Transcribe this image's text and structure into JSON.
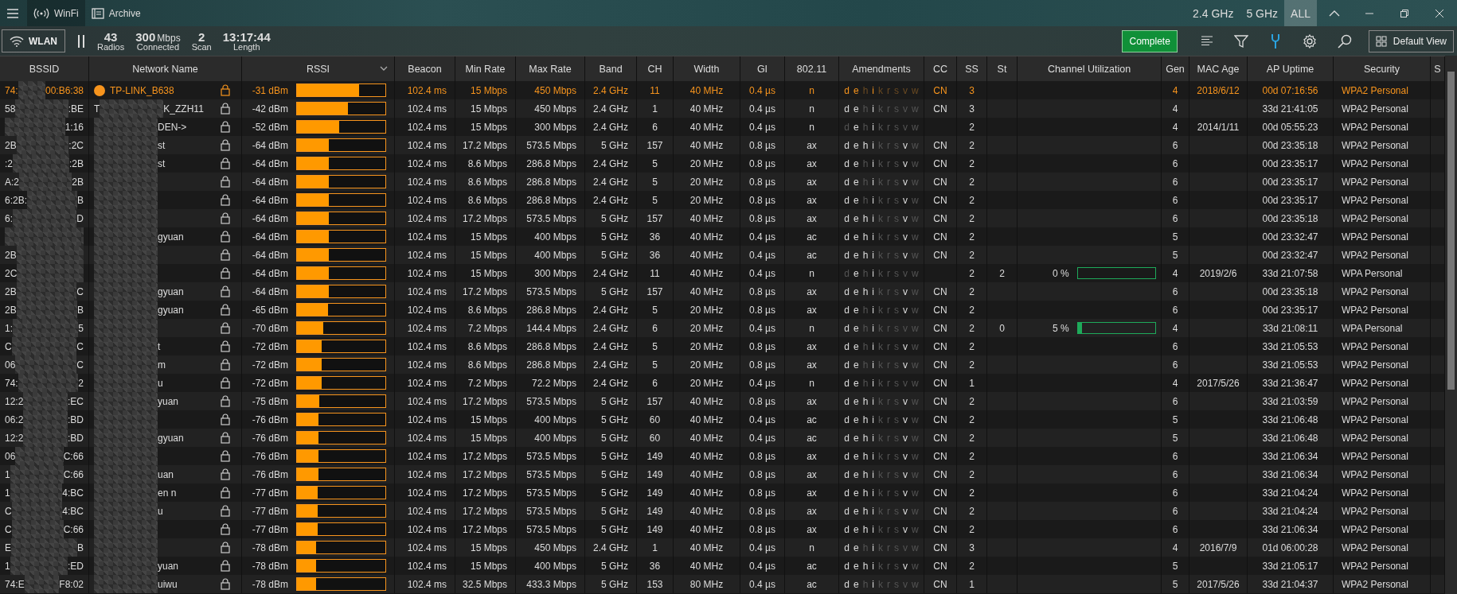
{
  "titlebar": {
    "app_tabs": [
      {
        "kind": "wifi",
        "label": "WinFi",
        "selected": true
      },
      {
        "kind": "archive",
        "label": "Archive",
        "selected": false
      }
    ],
    "bands": [
      {
        "label": "2.4 GHz",
        "selected": false
      },
      {
        "label": "5 GHz",
        "selected": false
      },
      {
        "label": "ALL",
        "selected": true
      }
    ]
  },
  "toolbar": {
    "wlan": "WLAN",
    "stats": [
      {
        "value": "43",
        "label": "Radios"
      },
      {
        "value": "300",
        "unit": "Mbps",
        "label": "Connected"
      },
      {
        "value": "2",
        "label": "Scan"
      },
      {
        "value": "13:17:44",
        "label": "Length"
      }
    ],
    "status": "Complete",
    "view": "Default View"
  },
  "columns": [
    {
      "label": "BSSID",
      "sorted": false
    },
    {
      "label": "Network Name",
      "sorted": false
    },
    {
      "label": "RSSI",
      "sorted": true
    },
    {
      "label": "Beacon",
      "sorted": false
    },
    {
      "label": "Min Rate",
      "sorted": false
    },
    {
      "label": "Max Rate",
      "sorted": false
    },
    {
      "label": "Band",
      "sorted": false
    },
    {
      "label": "CH",
      "sorted": false
    },
    {
      "label": "Width",
      "sorted": false
    },
    {
      "label": "GI",
      "sorted": false
    },
    {
      "label": "802.11",
      "sorted": false
    },
    {
      "label": "Amendments",
      "sorted": false
    },
    {
      "label": "CC",
      "sorted": false
    },
    {
      "label": "SS",
      "sorted": false
    },
    {
      "label": "St",
      "sorted": false
    },
    {
      "label": "Channel Utilization",
      "sorted": false
    },
    {
      "label": "Gen",
      "sorted": false
    },
    {
      "label": "MAC Age",
      "sorted": false
    },
    {
      "label": "AP Uptime",
      "sorted": false
    },
    {
      "label": "Security",
      "sorted": false
    },
    {
      "label": "S",
      "sorted": false
    }
  ],
  "rows": [
    {
      "bssid": {
        "start": "74:",
        "end": "00:B6:38",
        "redacted": true
      },
      "name": {
        "end": "TP-LINK_B638",
        "redacted": false
      },
      "connected": true,
      "rssi": "-31 dBm",
      "level": 0.7,
      "beacon": "102.4 ms",
      "min_rate": "15 Mbps",
      "max_rate": "450 Mbps",
      "band": "2.4 GHz",
      "ch": "11",
      "width": "40 MHz",
      "gi": "0.4 µs",
      "std": "n",
      "amendments": {
        "letters": "d e h i k r s v w",
        "on": [
          true,
          true,
          false,
          true,
          false,
          false,
          false,
          false,
          false
        ]
      },
      "cc": "CN",
      "ss": "3",
      "gen": "4",
      "mac_age": "2018/6/12",
      "uptime": "00d 07:16:56",
      "security": "WPA2 Personal"
    },
    {
      "bssid": {
        "start": "58",
        "end": ":BE",
        "redacted": true
      },
      "name": {
        "start": "T",
        "end": "K_ZZH11",
        "redacted": true
      },
      "connected": false,
      "rssi": "-42 dBm",
      "level": 0.58,
      "beacon": "102.4 ms",
      "min_rate": "15 Mbps",
      "max_rate": "450 Mbps",
      "band": "2.4 GHz",
      "ch": "1",
      "width": "40 MHz",
      "gi": "0.4 µs",
      "std": "n",
      "amendments": {
        "letters": "d e h i k r s v w",
        "on": [
          true,
          true,
          false,
          true,
          false,
          false,
          false,
          false,
          false
        ]
      },
      "cc": "CN",
      "ss": "3",
      "gen": "4",
      "uptime": "33d 21:41:05",
      "security": "WPA2 Personal"
    },
    {
      "bssid": {
        "end": "1:16",
        "redacted": true
      },
      "name": {
        "end": "DEN->",
        "redacted": true
      },
      "connected": false,
      "rssi": "-52 dBm",
      "level": 0.48,
      "beacon": "102.4 ms",
      "min_rate": "15 Mbps",
      "max_rate": "300 Mbps",
      "band": "2.4 GHz",
      "ch": "6",
      "width": "40 MHz",
      "gi": "0.4 µs",
      "std": "n",
      "amendments": {
        "letters": "d e h i k r s v w",
        "on": [
          false,
          true,
          false,
          true,
          false,
          false,
          false,
          false,
          false
        ]
      },
      "ss": "2",
      "gen": "4",
      "mac_age": "2014/1/11",
      "uptime": "00d 05:55:23",
      "security": "WPA2 Personal"
    },
    {
      "bssid": {
        "start": "2B",
        "end": ":2C",
        "redacted": true
      },
      "name": {
        "end": "st",
        "redacted": true
      },
      "connected": false,
      "rssi": "-64 dBm",
      "level": 0.36,
      "beacon": "102.4 ms",
      "min_rate": "17.2 Mbps",
      "max_rate": "573.5 Mbps",
      "band": "5 GHz",
      "ch": "157",
      "width": "40 MHz",
      "gi": "0.8 µs",
      "std": "ax",
      "amendments": {
        "letters": "d e h i k r s v w",
        "on": [
          true,
          true,
          true,
          true,
          false,
          false,
          false,
          true,
          false
        ]
      },
      "cc": "CN",
      "ss": "2",
      "gen": "6",
      "uptime": "00d 23:35:18",
      "security": "WPA2 Personal"
    },
    {
      "bssid": {
        "start": ":2",
        "end": ":2B",
        "redacted": true
      },
      "name": {
        "end": "st",
        "redacted": true
      },
      "connected": false,
      "rssi": "-64 dBm",
      "level": 0.36,
      "beacon": "102.4 ms",
      "min_rate": "8.6 Mbps",
      "max_rate": "286.8 Mbps",
      "band": "2.4 GHz",
      "ch": "5",
      "width": "20 MHz",
      "gi": "0.8 µs",
      "std": "ax",
      "amendments": {
        "letters": "d e h i k r s v w",
        "on": [
          true,
          true,
          false,
          true,
          false,
          false,
          false,
          true,
          false
        ]
      },
      "cc": "CN",
      "ss": "2",
      "gen": "6",
      "uptime": "00d 23:35:17",
      "security": "WPA2 Personal"
    },
    {
      "bssid": {
        "start": "A:2",
        "end": "2B",
        "redacted": true
      },
      "name": {
        "redacted": true
      },
      "connected": false,
      "rssi": "-64 dBm",
      "level": 0.36,
      "beacon": "102.4 ms",
      "min_rate": "8.6 Mbps",
      "max_rate": "286.8 Mbps",
      "band": "2.4 GHz",
      "ch": "5",
      "width": "20 MHz",
      "gi": "0.8 µs",
      "std": "ax",
      "amendments": {
        "letters": "d e h i k r s v w",
        "on": [
          true,
          true,
          false,
          true,
          false,
          false,
          false,
          true,
          false
        ]
      },
      "cc": "CN",
      "ss": "2",
      "gen": "6",
      "uptime": "00d 23:35:17",
      "security": "WPA2 Personal"
    },
    {
      "bssid": {
        "start": "6:2B:",
        "end": "B",
        "redacted": true
      },
      "name": {
        "redacted": true
      },
      "connected": false,
      "rssi": "-64 dBm",
      "level": 0.36,
      "beacon": "102.4 ms",
      "min_rate": "8.6 Mbps",
      "max_rate": "286.8 Mbps",
      "band": "2.4 GHz",
      "ch": "5",
      "width": "20 MHz",
      "gi": "0.8 µs",
      "std": "ax",
      "amendments": {
        "letters": "d e h i k r s v w",
        "on": [
          true,
          true,
          false,
          true,
          false,
          false,
          false,
          true,
          false
        ]
      },
      "cc": "CN",
      "ss": "2",
      "gen": "6",
      "uptime": "00d 23:35:17",
      "security": "WPA2 Personal"
    },
    {
      "bssid": {
        "start": "6:",
        "end": "D",
        "redacted": true
      },
      "name": {
        "redacted": true
      },
      "connected": false,
      "rssi": "-64 dBm",
      "level": 0.36,
      "beacon": "102.4 ms",
      "min_rate": "17.2 Mbps",
      "max_rate": "573.5 Mbps",
      "band": "5 GHz",
      "ch": "157",
      "width": "40 MHz",
      "gi": "0.8 µs",
      "std": "ax",
      "amendments": {
        "letters": "d e h i k r s v w",
        "on": [
          true,
          true,
          true,
          true,
          false,
          false,
          false,
          true,
          false
        ]
      },
      "cc": "CN",
      "ss": "2",
      "gen": "6",
      "uptime": "00d 23:35:18",
      "security": "WPA2 Personal"
    },
    {
      "bssid": {
        "redacted": true
      },
      "name": {
        "end": "gyuan",
        "redacted": true
      },
      "connected": false,
      "rssi": "-64 dBm",
      "level": 0.36,
      "beacon": "102.4 ms",
      "min_rate": "15 Mbps",
      "max_rate": "400 Mbps",
      "band": "5 GHz",
      "ch": "36",
      "width": "40 MHz",
      "gi": "0.4 µs",
      "std": "ac",
      "amendments": {
        "letters": "d e h i k r s v w",
        "on": [
          true,
          true,
          true,
          true,
          false,
          false,
          false,
          true,
          false
        ]
      },
      "cc": "CN",
      "ss": "2",
      "gen": "5",
      "uptime": "00d 23:32:47",
      "security": "WPA2 Personal"
    },
    {
      "bssid": {
        "start": "2B",
        "redacted": true
      },
      "name": {
        "redacted": true
      },
      "connected": false,
      "rssi": "-64 dBm",
      "level": 0.36,
      "beacon": "102.4 ms",
      "min_rate": "15 Mbps",
      "max_rate": "400 Mbps",
      "band": "5 GHz",
      "ch": "36",
      "width": "40 MHz",
      "gi": "0.4 µs",
      "std": "ac",
      "amendments": {
        "letters": "d e h i k r s v w",
        "on": [
          true,
          true,
          true,
          true,
          false,
          false,
          false,
          true,
          false
        ]
      },
      "cc": "CN",
      "ss": "2",
      "gen": "5",
      "uptime": "00d 23:32:47",
      "security": "WPA2 Personal"
    },
    {
      "bssid": {
        "start": "2C",
        "redacted": true
      },
      "name": {
        "redacted": true
      },
      "connected": false,
      "rssi": "-64 dBm",
      "level": 0.36,
      "beacon": "102.4 ms",
      "min_rate": "15 Mbps",
      "max_rate": "300 Mbps",
      "band": "2.4 GHz",
      "ch": "11",
      "width": "40 MHz",
      "gi": "0.4 µs",
      "std": "n",
      "amendments": {
        "letters": "d e h i k r s v w",
        "on": [
          false,
          true,
          false,
          true,
          false,
          false,
          false,
          false,
          false
        ]
      },
      "ss": "2",
      "st": "2",
      "util": {
        "text": "0 %"
      },
      "gen": "4",
      "mac_age": "2019/2/6",
      "uptime": "33d 21:07:58",
      "security": "WPA Personal"
    },
    {
      "bssid": {
        "start": "2B",
        "end": "C",
        "redacted": true
      },
      "name": {
        "end": "gyuan",
        "redacted": true
      },
      "connected": false,
      "rssi": "-64 dBm",
      "level": 0.36,
      "beacon": "102.4 ms",
      "min_rate": "17.2 Mbps",
      "max_rate": "573.5 Mbps",
      "band": "5 GHz",
      "ch": "157",
      "width": "40 MHz",
      "gi": "0.8 µs",
      "std": "ax",
      "amendments": {
        "letters": "d e h i k r s v w",
        "on": [
          true,
          true,
          true,
          true,
          false,
          false,
          false,
          true,
          false
        ]
      },
      "cc": "CN",
      "ss": "2",
      "gen": "6",
      "uptime": "00d 23:35:18",
      "security": "WPA2 Personal"
    },
    {
      "bssid": {
        "start": "2B",
        "end": "B",
        "redacted": true
      },
      "name": {
        "end": "gyuan",
        "redacted": true
      },
      "connected": false,
      "rssi": "-65 dBm",
      "level": 0.35,
      "beacon": "102.4 ms",
      "min_rate": "8.6 Mbps",
      "max_rate": "286.8 Mbps",
      "band": "2.4 GHz",
      "ch": "5",
      "width": "20 MHz",
      "gi": "0.8 µs",
      "std": "ax",
      "amendments": {
        "letters": "d e h i k r s v w",
        "on": [
          true,
          true,
          false,
          true,
          false,
          false,
          false,
          true,
          false
        ]
      },
      "cc": "CN",
      "ss": "2",
      "gen": "6",
      "uptime": "00d 23:35:17",
      "security": "WPA2 Personal"
    },
    {
      "bssid": {
        "start": "1:",
        "end": "5",
        "redacted": true
      },
      "name": {
        "redacted": true
      },
      "connected": false,
      "rssi": "-70 dBm",
      "level": 0.3,
      "beacon": "102.4 ms",
      "min_rate": "7.2 Mbps",
      "max_rate": "144.4 Mbps",
      "band": "2.4 GHz",
      "ch": "6",
      "width": "20 MHz",
      "gi": "0.4 µs",
      "std": "n",
      "amendments": {
        "letters": "d e h i k r s v w",
        "on": [
          true,
          true,
          false,
          true,
          false,
          false,
          false,
          false,
          false
        ]
      },
      "cc": "CN",
      "ss": "2",
      "st": "0",
      "util": {
        "text": "5 %",
        "level": 0.05
      },
      "gen": "4",
      "uptime": "33d 21:08:11",
      "security": "WPA Personal"
    },
    {
      "bssid": {
        "start": "C",
        "end": "C",
        "redacted": true
      },
      "name": {
        "end": "t",
        "redacted": true
      },
      "connected": false,
      "rssi": "-72 dBm",
      "level": 0.28,
      "beacon": "102.4 ms",
      "min_rate": "8.6 Mbps",
      "max_rate": "286.8 Mbps",
      "band": "2.4 GHz",
      "ch": "5",
      "width": "20 MHz",
      "gi": "0.8 µs",
      "std": "ax",
      "amendments": {
        "letters": "d e h i k r s v w",
        "on": [
          true,
          true,
          false,
          true,
          false,
          false,
          false,
          true,
          false
        ]
      },
      "cc": "CN",
      "ss": "2",
      "gen": "6",
      "uptime": "33d 21:05:53",
      "security": "WPA2 Personal"
    },
    {
      "bssid": {
        "start": "06",
        "end": "C",
        "redacted": true
      },
      "name": {
        "end": "m",
        "redacted": true
      },
      "connected": false,
      "rssi": "-72 dBm",
      "level": 0.28,
      "beacon": "102.4 ms",
      "min_rate": "8.6 Mbps",
      "max_rate": "286.8 Mbps",
      "band": "2.4 GHz",
      "ch": "5",
      "width": "20 MHz",
      "gi": "0.8 µs",
      "std": "ax",
      "amendments": {
        "letters": "d e h i k r s v w",
        "on": [
          true,
          true,
          false,
          true,
          false,
          false,
          false,
          true,
          false
        ]
      },
      "cc": "CN",
      "ss": "2",
      "gen": "6",
      "uptime": "33d 21:05:53",
      "security": "WPA2 Personal"
    },
    {
      "bssid": {
        "start": "74:",
        "end": "2",
        "redacted": true
      },
      "name": {
        "end": "u",
        "redacted": true
      },
      "connected": false,
      "rssi": "-72 dBm",
      "level": 0.28,
      "beacon": "102.4 ms",
      "min_rate": "7.2 Mbps",
      "max_rate": "72.2 Mbps",
      "band": "2.4 GHz",
      "ch": "6",
      "width": "20 MHz",
      "gi": "0.4 µs",
      "std": "n",
      "amendments": {
        "letters": "d e h i k r s v w",
        "on": [
          true,
          true,
          false,
          true,
          false,
          false,
          false,
          false,
          false
        ]
      },
      "cc": "CN",
      "ss": "1",
      "gen": "4",
      "mac_age": "2017/5/26",
      "uptime": "33d 21:36:47",
      "security": "WPA2 Personal"
    },
    {
      "bssid": {
        "start": "12:2",
        "end": ":EC",
        "redacted": true
      },
      "name": {
        "end": "yuan",
        "redacted": true
      },
      "connected": false,
      "rssi": "-75 dBm",
      "level": 0.25,
      "beacon": "102.4 ms",
      "min_rate": "17.2 Mbps",
      "max_rate": "573.5 Mbps",
      "band": "5 GHz",
      "ch": "157",
      "width": "40 MHz",
      "gi": "0.8 µs",
      "std": "ax",
      "amendments": {
        "letters": "d e h i k r s v w",
        "on": [
          true,
          true,
          true,
          true,
          false,
          false,
          false,
          true,
          false
        ]
      },
      "cc": "CN",
      "ss": "2",
      "gen": "6",
      "uptime": "33d 21:03:59",
      "security": "WPA2 Personal"
    },
    {
      "bssid": {
        "start": "06:2",
        "end": ":BD",
        "redacted": true
      },
      "name": {
        "redacted": true
      },
      "connected": false,
      "rssi": "-76 dBm",
      "level": 0.24,
      "beacon": "102.4 ms",
      "min_rate": "15 Mbps",
      "max_rate": "400 Mbps",
      "band": "5 GHz",
      "ch": "60",
      "width": "40 MHz",
      "gi": "0.4 µs",
      "std": "ac",
      "amendments": {
        "letters": "d e h i k r s v w",
        "on": [
          true,
          true,
          true,
          true,
          false,
          false,
          false,
          true,
          false
        ]
      },
      "cc": "CN",
      "ss": "2",
      "gen": "5",
      "uptime": "33d 21:06:48",
      "security": "WPA2 Personal"
    },
    {
      "bssid": {
        "start": "12:2",
        "end": ":BD",
        "redacted": true
      },
      "name": {
        "end": "gyuan",
        "redacted": true
      },
      "connected": false,
      "rssi": "-76 dBm",
      "level": 0.24,
      "beacon": "102.4 ms",
      "min_rate": "15 Mbps",
      "max_rate": "400 Mbps",
      "band": "5 GHz",
      "ch": "60",
      "width": "40 MHz",
      "gi": "0.4 µs",
      "std": "ac",
      "amendments": {
        "letters": "d e h i k r s v w",
        "on": [
          true,
          true,
          true,
          true,
          false,
          false,
          false,
          true,
          false
        ]
      },
      "cc": "CN",
      "ss": "2",
      "gen": "5",
      "uptime": "33d 21:06:48",
      "security": "WPA2 Personal"
    },
    {
      "bssid": {
        "start": "06",
        "end": "C:66",
        "redacted": true
      },
      "name": {
        "redacted": true
      },
      "connected": false,
      "rssi": "-76 dBm",
      "level": 0.24,
      "beacon": "102.4 ms",
      "min_rate": "17.2 Mbps",
      "max_rate": "573.5 Mbps",
      "band": "5 GHz",
      "ch": "149",
      "width": "40 MHz",
      "gi": "0.8 µs",
      "std": "ax",
      "amendments": {
        "letters": "d e h i k r s v w",
        "on": [
          true,
          true,
          true,
          true,
          false,
          false,
          false,
          true,
          false
        ]
      },
      "cc": "CN",
      "ss": "2",
      "gen": "6",
      "uptime": "33d 21:06:34",
      "security": "WPA2 Personal"
    },
    {
      "bssid": {
        "start": "1",
        "end": "C:66",
        "redacted": true
      },
      "name": {
        "end": "uan",
        "redacted": true
      },
      "connected": false,
      "rssi": "-76 dBm",
      "level": 0.24,
      "beacon": "102.4 ms",
      "min_rate": "17.2 Mbps",
      "max_rate": "573.5 Mbps",
      "band": "5 GHz",
      "ch": "149",
      "width": "40 MHz",
      "gi": "0.8 µs",
      "std": "ax",
      "amendments": {
        "letters": "d e h i k r s v w",
        "on": [
          true,
          true,
          true,
          true,
          false,
          false,
          false,
          true,
          false
        ]
      },
      "cc": "CN",
      "ss": "2",
      "gen": "6",
      "uptime": "33d 21:06:34",
      "security": "WPA2 Personal"
    },
    {
      "bssid": {
        "start": "1",
        "end": "4:BC",
        "redacted": true
      },
      "name": {
        "end": "en n",
        "redacted": true
      },
      "connected": false,
      "rssi": "-77 dBm",
      "level": 0.23,
      "beacon": "102.4 ms",
      "min_rate": "17.2 Mbps",
      "max_rate": "573.5 Mbps",
      "band": "5 GHz",
      "ch": "149",
      "width": "40 MHz",
      "gi": "0.8 µs",
      "std": "ax",
      "amendments": {
        "letters": "d e h i k r s v w",
        "on": [
          true,
          true,
          true,
          true,
          false,
          false,
          false,
          true,
          false
        ]
      },
      "cc": "CN",
      "ss": "2",
      "gen": "6",
      "uptime": "33d 21:04:24",
      "security": "WPA2 Personal"
    },
    {
      "bssid": {
        "start": "C",
        "end": "4:BC",
        "redacted": true
      },
      "name": {
        "end": "u",
        "redacted": true
      },
      "connected": false,
      "rssi": "-77 dBm",
      "level": 0.23,
      "beacon": "102.4 ms",
      "min_rate": "17.2 Mbps",
      "max_rate": "573.5 Mbps",
      "band": "5 GHz",
      "ch": "149",
      "width": "40 MHz",
      "gi": "0.8 µs",
      "std": "ax",
      "amendments": {
        "letters": "d e h i k r s v w",
        "on": [
          true,
          true,
          true,
          true,
          false,
          false,
          false,
          true,
          false
        ]
      },
      "cc": "CN",
      "ss": "2",
      "gen": "6",
      "uptime": "33d 21:04:24",
      "security": "WPA2 Personal"
    },
    {
      "bssid": {
        "start": "C",
        "end": "C:66",
        "redacted": true
      },
      "name": {
        "redacted": true
      },
      "connected": false,
      "rssi": "-77 dBm",
      "level": 0.23,
      "beacon": "102.4 ms",
      "min_rate": "17.2 Mbps",
      "max_rate": "573.5 Mbps",
      "band": "5 GHz",
      "ch": "149",
      "width": "40 MHz",
      "gi": "0.8 µs",
      "std": "ax",
      "amendments": {
        "letters": "d e h i k r s v w",
        "on": [
          true,
          true,
          true,
          true,
          false,
          false,
          false,
          true,
          false
        ]
      },
      "cc": "CN",
      "ss": "2",
      "gen": "6",
      "uptime": "33d 21:06:34",
      "security": "WPA2 Personal"
    },
    {
      "bssid": {
        "start": "E",
        "end": "B",
        "redacted": true
      },
      "name": {
        "redacted": true
      },
      "connected": false,
      "rssi": "-78 dBm",
      "level": 0.22,
      "beacon": "102.4 ms",
      "min_rate": "15 Mbps",
      "max_rate": "450 Mbps",
      "band": "2.4 GHz",
      "ch": "1",
      "width": "40 MHz",
      "gi": "0.4 µs",
      "std": "n",
      "amendments": {
        "letters": "d e h i k r s v w",
        "on": [
          true,
          true,
          false,
          true,
          false,
          false,
          false,
          false,
          false
        ]
      },
      "cc": "CN",
      "ss": "3",
      "gen": "4",
      "mac_age": "2016/7/9",
      "uptime": "01d 06:00:28",
      "security": "WPA2 Personal"
    },
    {
      "bssid": {
        "start": "1",
        "end": ":ED",
        "redacted": true
      },
      "name": {
        "end": "yuan",
        "redacted": true
      },
      "connected": false,
      "rssi": "-78 dBm",
      "level": 0.22,
      "beacon": "102.4 ms",
      "min_rate": "15 Mbps",
      "max_rate": "400 Mbps",
      "band": "5 GHz",
      "ch": "36",
      "width": "40 MHz",
      "gi": "0.4 µs",
      "std": "ac",
      "amendments": {
        "letters": "d e h i k r s v w",
        "on": [
          true,
          true,
          true,
          true,
          false,
          false,
          false,
          true,
          false
        ]
      },
      "cc": "CN",
      "ss": "2",
      "gen": "5",
      "uptime": "33d 21:05:17",
      "security": "WPA2 Personal"
    },
    {
      "bssid": {
        "start": "74:E",
        "end": "F8:02",
        "redacted": true
      },
      "name": {
        "end": "uiwu",
        "redacted": true
      },
      "connected": false,
      "rssi": "-78 dBm",
      "level": 0.22,
      "beacon": "102.4 ms",
      "min_rate": "32.5 Mbps",
      "max_rate": "433.3 Mbps",
      "band": "5 GHz",
      "ch": "153",
      "width": "80 MHz",
      "gi": "0.4 µs",
      "std": "ac",
      "amendments": {
        "letters": "d e h i k r s v w",
        "on": [
          true,
          true,
          false,
          true,
          false,
          false,
          false,
          false,
          false
        ]
      },
      "cc": "CN",
      "ss": "1",
      "gen": "5",
      "mac_age": "2017/5/26",
      "uptime": "33d 21:04:37",
      "security": "WPA2 Personal"
    }
  ]
}
